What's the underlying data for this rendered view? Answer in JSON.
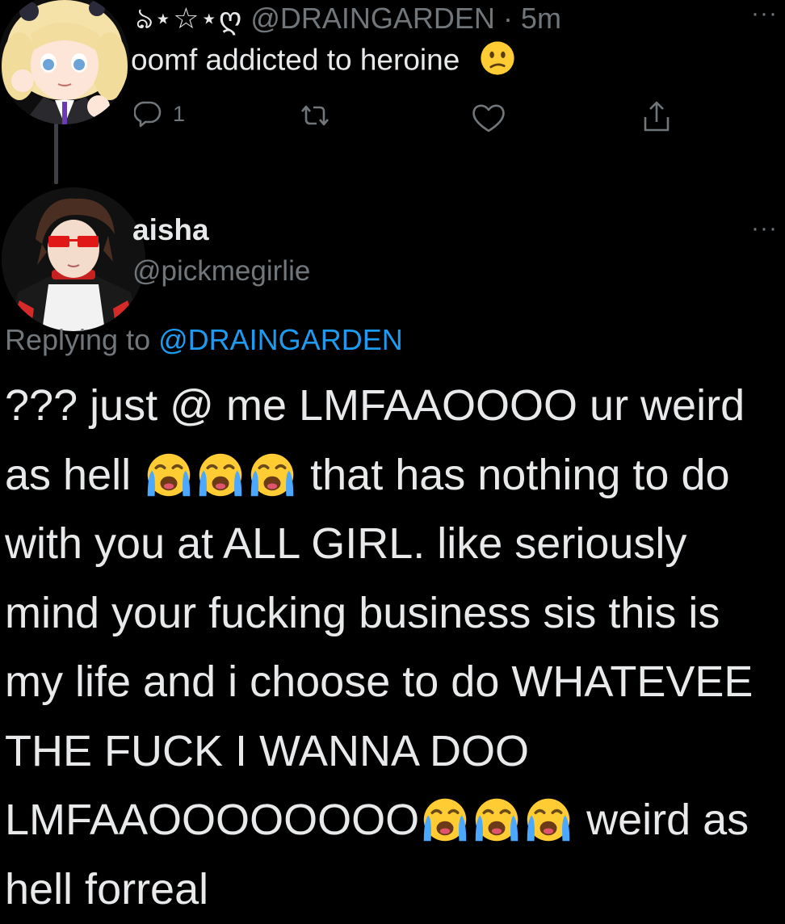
{
  "parent_tweet": {
    "name_decoration": "ঌ⋆☆⋆ღ",
    "handle": "@DRAINGARDEN",
    "time": "· 5m",
    "text": "oomf addicted to heroine",
    "text_emoji": "confused-face",
    "reply_count": "1"
  },
  "reply_tweet": {
    "display_name": "aisha",
    "handle": "@pickmegirlie",
    "replying_prefix": "Replying to",
    "replying_to": "@DRAINGARDEN",
    "lines": {
      "l1": "??? just @ me LMFAAOOOO ur weird",
      "l2a": "as hell",
      "l2b": "that has nothing to do",
      "l3": "with you at ALL GIRL. like seriously",
      "l4": "mind your fucking business sis this is",
      "l5": "my life and i choose to do WHATEVEE",
      "l6": "THE FUCK I WANNA DOO",
      "l7a": "LMFAAOOOOOOOO",
      "l7b": "weird as",
      "l8": "hell forreal"
    },
    "emoji": "loudly-crying-face"
  },
  "more_icon": "···",
  "colors": {
    "background": "#000000",
    "text": "#e7e9ea",
    "secondary": "#71767b",
    "link": "#1d9bf0",
    "thread_line": "#3d4145"
  }
}
